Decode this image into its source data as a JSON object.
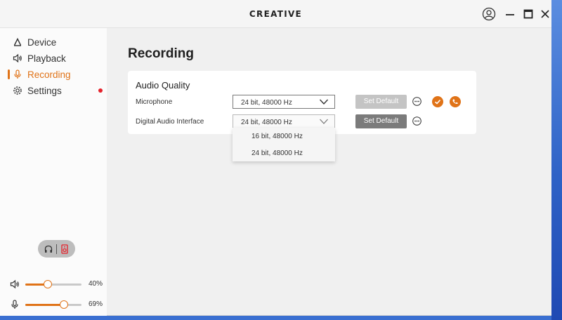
{
  "app": {
    "brand": "CREATIVE"
  },
  "sidebar": {
    "items": [
      {
        "label": "Device",
        "icon": "device-icon"
      },
      {
        "label": "Playback",
        "icon": "speaker-icon"
      },
      {
        "label": "Recording",
        "icon": "microphone-icon",
        "active": true
      },
      {
        "label": "Settings",
        "icon": "gear-icon",
        "badge": "red-dot"
      }
    ],
    "output_toggle": {
      "options": [
        "headphones-icon",
        "speaker-icon"
      ],
      "selected": "speaker-icon"
    },
    "volume": {
      "playback_percent": 40,
      "playback_label": "40%",
      "mic_percent": 69,
      "mic_label": "69%"
    }
  },
  "main": {
    "title": "Recording",
    "section_title": "Audio Quality",
    "rows": [
      {
        "label": "Microphone",
        "value": "24 bit, 48000 Hz",
        "button": "Set Default",
        "button_state": "disabled",
        "is_default": true
      },
      {
        "label": "Digital Audio Interface",
        "value": "24 bit, 48000 Hz",
        "button": "Set Default",
        "button_state": "enabled"
      }
    ],
    "dropdown_options": [
      "16 bit, 48000 Hz",
      "24 bit, 48000 Hz"
    ]
  },
  "colors": {
    "accent": "#e07318",
    "badge": "#e5222c",
    "button_disabled": "#c4c4c4",
    "button_enabled": "#7b7b7b"
  }
}
